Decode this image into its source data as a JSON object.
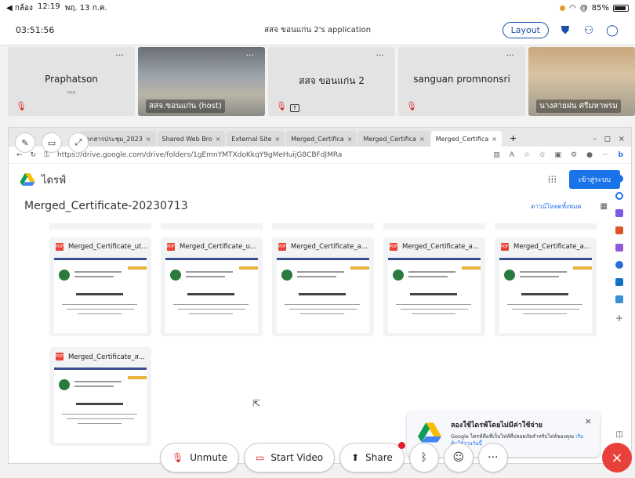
{
  "status_bar": {
    "back": "◀ กล้อง",
    "time": "12:19",
    "date": "พฤ. 13 ก.ค.",
    "battery": "85%"
  },
  "zoom_header": {
    "timer": "03:51:56",
    "app_title": "สสจ ขอนแก่น 2's application",
    "layout_label": "Layout"
  },
  "participants": [
    {
      "name": "Praphatson",
      "sub": "me",
      "video": false,
      "label": ""
    },
    {
      "name": "",
      "sub": "",
      "video": true,
      "label": "สสจ.ขอนแก่น (host)"
    },
    {
      "name": "สสจ ขอนแก่น 2",
      "sub": "",
      "video": false,
      "label": ""
    },
    {
      "name": "sanguan promnonsri",
      "sub": "",
      "video": false,
      "label": ""
    },
    {
      "name": "",
      "sub": "",
      "video": true,
      "label": "นางสายฝน ศรีมหาพรม"
    }
  ],
  "browser": {
    "tabs": [
      {
        "label": "เอกสารประชุม_2023",
        "active": false
      },
      {
        "label": "Shared Web Bro",
        "active": false
      },
      {
        "label": "External Site",
        "active": false
      },
      {
        "label": "Merged_Certifica",
        "active": false
      },
      {
        "label": "Merged_Certifica",
        "active": false
      },
      {
        "label": "Merged_Certifica",
        "active": true
      }
    ],
    "url": "https://drive.google.com/drive/folders/1gEmnYMTXdoKkqY9gMeHuijG8CBFdJMRa"
  },
  "drive": {
    "title": "ไดรฟ์",
    "signin_label": "เข้าสู่ระบบ",
    "folder_title": "Merged_Certificate-20230713",
    "download_all": "ดาวน์โหลดทั้งหมด",
    "files": [
      {
        "name": "Merged_Certificate_ut..."
      },
      {
        "name": "Merged_Certificate_u..."
      },
      {
        "name": "Merged_Certificate_a..."
      },
      {
        "name": "Merged_Certificate_a..."
      },
      {
        "name": "Merged_Certificate_a..."
      },
      {
        "name": "Merged_Certificate_ส..."
      }
    ]
  },
  "promo": {
    "title": "ลองใช้ไดรฟ์โดยไม่มีค่าใช้จ่าย",
    "text": "Google ไดรฟ์คือที่เก็บไฟล์ที่ปลอดภัยสำหรับไฟล์ของคุณ",
    "link": "เริ่มต้นใช้งานวันนี้"
  },
  "controls": {
    "unmute": "Unmute",
    "start_video": "Start Video",
    "share": "Share",
    "more": "···"
  }
}
